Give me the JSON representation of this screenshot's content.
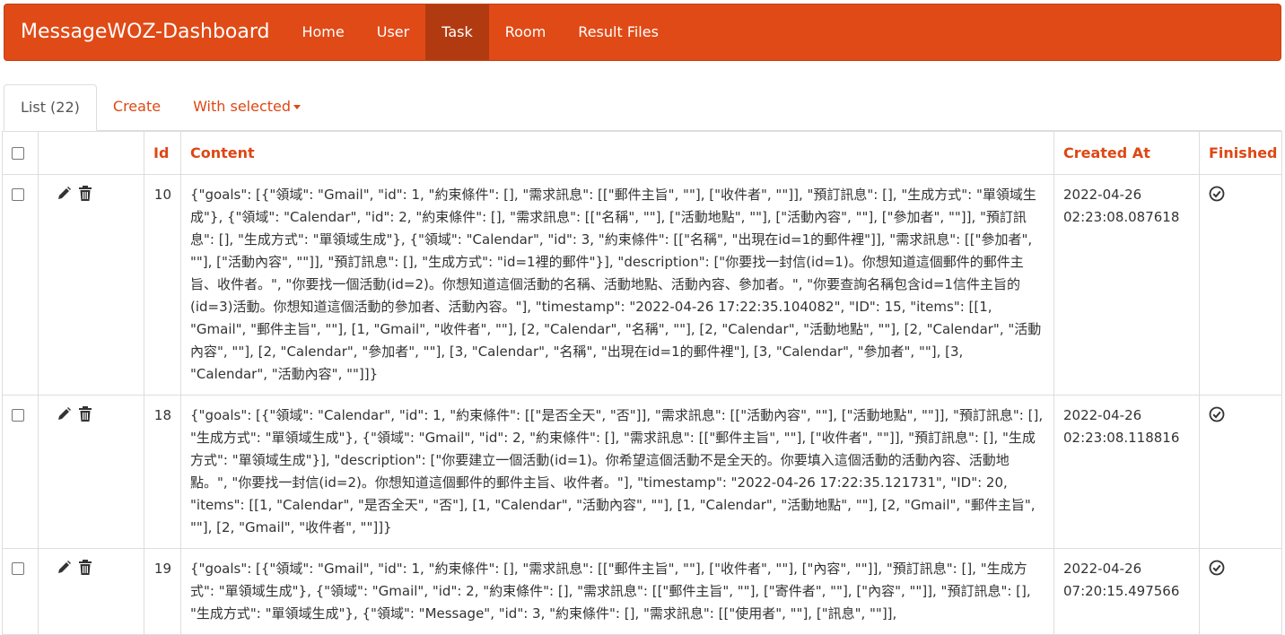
{
  "navbar": {
    "brand": "MessageWOZ-Dashboard",
    "items": [
      {
        "label": "Home",
        "active": false
      },
      {
        "label": "User",
        "active": false
      },
      {
        "label": "Task",
        "active": true
      },
      {
        "label": "Room",
        "active": false
      },
      {
        "label": "Result Files",
        "active": false
      }
    ]
  },
  "tabs": {
    "list": "List (22)",
    "create": "Create",
    "with_selected": "With selected"
  },
  "table": {
    "headers": {
      "id": "Id",
      "content": "Content",
      "created_at": "Created At",
      "finished": "Finished"
    },
    "rows": [
      {
        "id": "10",
        "content": "{\"goals\": [{\"領域\": \"Gmail\", \"id\": 1, \"約束條件\": [], \"需求訊息\": [[\"郵件主旨\", \"\"], [\"收件者\", \"\"]], \"預訂訊息\": [], \"生成方式\": \"單領域生成\"}, {\"領域\": \"Calendar\", \"id\": 2, \"約束條件\": [], \"需求訊息\": [[\"名稱\", \"\"], [\"活動地點\", \"\"], [\"活動內容\", \"\"], [\"參加者\", \"\"]], \"預訂訊息\": [], \"生成方式\": \"單領域生成\"}, {\"領域\": \"Calendar\", \"id\": 3, \"約束條件\": [[\"名稱\", \"出現在id=1的郵件裡\"]], \"需求訊息\": [[\"參加者\", \"\"], [\"活動內容\", \"\"]], \"預訂訊息\": [], \"生成方式\": \"id=1裡的郵件\"}], \"description\": [\"你要找一封信(id=1)。你想知道這個郵件的郵件主旨、收件者。\", \"你要找一個活動(id=2)。你想知道這個活動的名稱、活動地點、活動內容、參加者。\", \"你要查詢名稱包含id=1信件主旨的(id=3)活動。你想知道這個活動的參加者、活動內容。\"], \"timestamp\": \"2022-04-26 17:22:35.104082\", \"ID\": 15, \"items\": [[1, \"Gmail\", \"郵件主旨\", \"\"], [1, \"Gmail\", \"收件者\", \"\"], [2, \"Calendar\", \"名稱\", \"\"], [2, \"Calendar\", \"活動地點\", \"\"], [2, \"Calendar\", \"活動內容\", \"\"], [2, \"Calendar\", \"參加者\", \"\"], [3, \"Calendar\", \"名稱\", \"出現在id=1的郵件裡\"], [3, \"Calendar\", \"參加者\", \"\"], [3, \"Calendar\", \"活動內容\", \"\"]]}",
        "created_at_date": "2022-04-26",
        "created_at_time": "02:23:08.087618",
        "finished": true
      },
      {
        "id": "18",
        "content": "{\"goals\": [{\"領域\": \"Calendar\", \"id\": 1, \"約束條件\": [[\"是否全天\", \"否\"]], \"需求訊息\": [[\"活動內容\", \"\"], [\"活動地點\", \"\"]], \"預訂訊息\": [], \"生成方式\": \"單領域生成\"}, {\"領域\": \"Gmail\", \"id\": 2, \"約束條件\": [], \"需求訊息\": [[\"郵件主旨\", \"\"], [\"收件者\", \"\"]], \"預訂訊息\": [], \"生成方式\": \"單領域生成\"}], \"description\": [\"你要建立一個活動(id=1)。你希望這個活動不是全天的。你要填入這個活動的活動內容、活動地點。\", \"你要找一封信(id=2)。你想知道這個郵件的郵件主旨、收件者。\"], \"timestamp\": \"2022-04-26 17:22:35.121731\", \"ID\": 20, \"items\": [[1, \"Calendar\", \"是否全天\", \"否\"], [1, \"Calendar\", \"活動內容\", \"\"], [1, \"Calendar\", \"活動地點\", \"\"], [2, \"Gmail\", \"郵件主旨\", \"\"], [2, \"Gmail\", \"收件者\", \"\"]]}",
        "created_at_date": "2022-04-26",
        "created_at_time": "02:23:08.118816",
        "finished": true
      },
      {
        "id": "19",
        "content": "{\"goals\": [{\"領域\": \"Gmail\", \"id\": 1, \"約束條件\": [], \"需求訊息\": [[\"郵件主旨\", \"\"], [\"收件者\", \"\"], [\"內容\", \"\"]], \"預訂訊息\": [], \"生成方式\": \"單領域生成\"}, {\"領域\": \"Gmail\", \"id\": 2, \"約束條件\": [], \"需求訊息\": [[\"郵件主旨\", \"\"], [\"寄件者\", \"\"], [\"內容\", \"\"]], \"預訂訊息\": [], \"生成方式\": \"單領域生成\"}, {\"領域\": \"Message\", \"id\": 3, \"約束條件\": [], \"需求訊息\": [[\"使用者\", \"\"], [\"訊息\", \"\"]],",
        "created_at_date": "2022-04-26",
        "created_at_time": "07:20:15.497566",
        "finished": true
      }
    ]
  },
  "icons": {
    "edit": "pencil-icon",
    "delete": "trash-icon",
    "finished": "check-circle-icon"
  },
  "colors": {
    "navbar_bg": "#e04a17",
    "navbar_active": "#b23a10",
    "accent_text": "#dd4814"
  }
}
